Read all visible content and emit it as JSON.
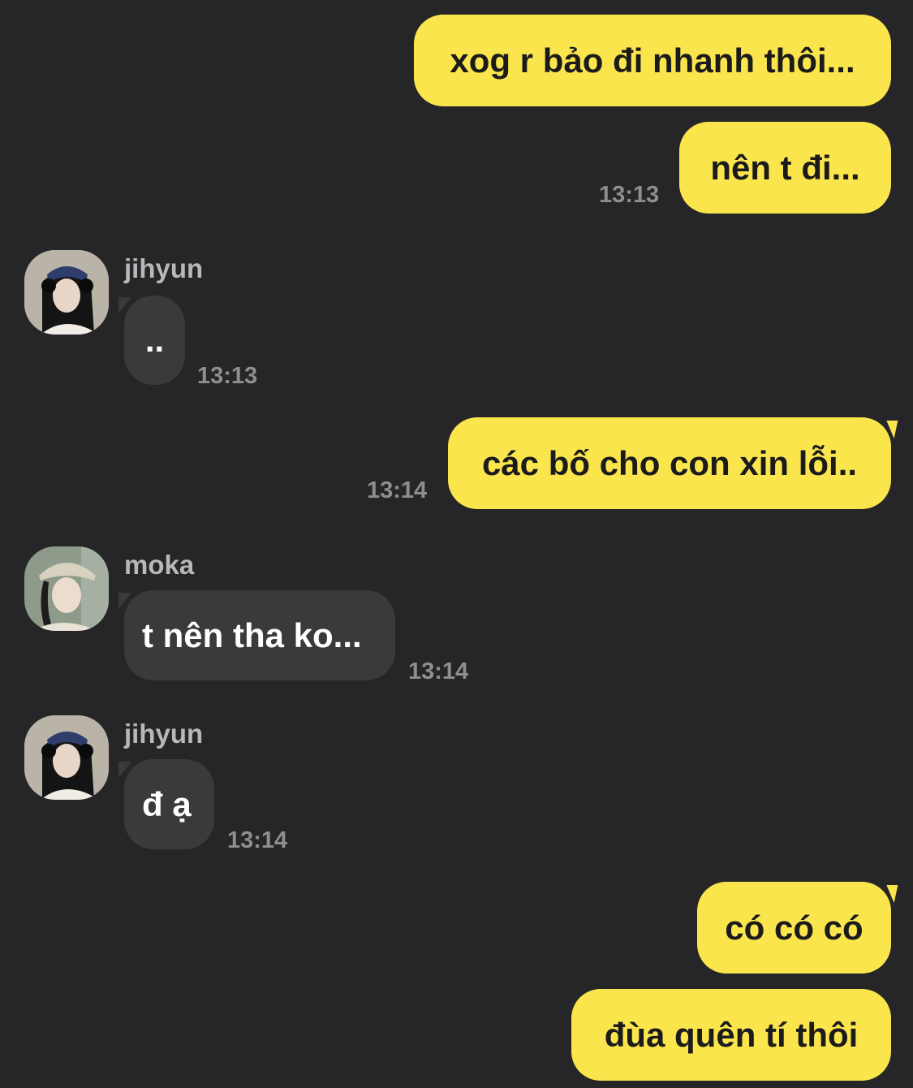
{
  "messages": [
    {
      "text": "xog r bảo đi nhanh thôi..."
    },
    {
      "text": "nên t đi...",
      "time": "13:13"
    },
    {
      "sender": "jihyun",
      "text": "..",
      "time": "13:13"
    },
    {
      "text": "các bố cho con xin lỗi..",
      "time": "13:14"
    },
    {
      "sender": "moka",
      "text": "t nên tha ko...",
      "time": "13:14"
    },
    {
      "sender": "jihyun",
      "text": "đ ạ",
      "time": "13:14"
    },
    {
      "text": "có có có"
    },
    {
      "text": "đùa quên tí thôi"
    }
  ],
  "colors": {
    "background": "#262628",
    "outgoing_bubble": "#fbe54d",
    "incoming_bubble": "#3a3a3c"
  },
  "icons": [
    "avatar-jihyun",
    "avatar-moka"
  ]
}
